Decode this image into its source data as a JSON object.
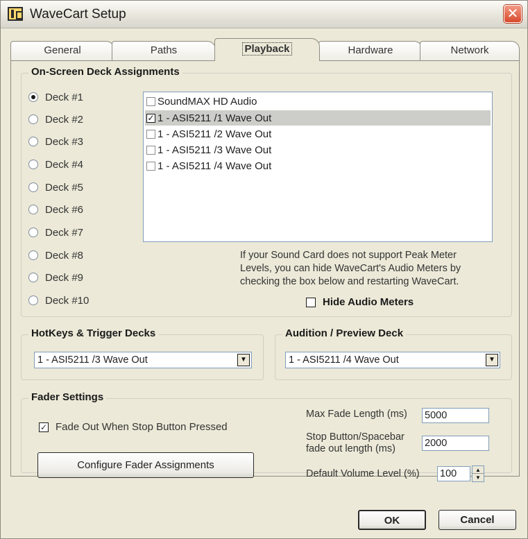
{
  "window": {
    "title": "WaveCart Setup"
  },
  "tabs": [
    {
      "label": "General"
    },
    {
      "label": "Paths"
    },
    {
      "label": "Playback",
      "active": true
    },
    {
      "label": "Hardware"
    },
    {
      "label": "Network"
    }
  ],
  "deck_assignments": {
    "title": "On-Screen Deck Assignments",
    "decks": [
      "Deck #1",
      "Deck #2",
      "Deck #3",
      "Deck #4",
      "Deck #5",
      "Deck #6",
      "Deck #7",
      "Deck #8",
      "Deck #9",
      "Deck #10"
    ],
    "selected_deck": "Deck #1",
    "devices": [
      {
        "label": "SoundMAX HD Audio",
        "checked": false
      },
      {
        "label": "1 - ASI5211 /1 Wave Out",
        "checked": true,
        "selected": true
      },
      {
        "label": "1 - ASI5211 /2 Wave Out",
        "checked": false
      },
      {
        "label": "1 - ASI5211 /3 Wave Out",
        "checked": false
      },
      {
        "label": "1 - ASI5211 /4 Wave Out",
        "checked": false
      }
    ],
    "note_lines": [
      "If your Sound Card does not support Peak Meter",
      "Levels, you can hide WaveCart's Audio Meters by",
      "checking the box below and restarting WaveCart."
    ],
    "hide_meters_label": "Hide Audio Meters",
    "hide_meters_checked": false
  },
  "hotkeys": {
    "title": "HotKeys & Trigger Decks",
    "value": "1 - ASI5211 /3 Wave Out"
  },
  "audition": {
    "title": "Audition / Preview Deck",
    "value": "1 - ASI5211 /4 Wave Out"
  },
  "fader": {
    "title": "Fader Settings",
    "fade_out_label": "Fade Out When Stop Button Pressed",
    "fade_out_checked": true,
    "configure_label": "Configure Fader Assignments",
    "max_fade_label": "Max Fade Length (ms)",
    "max_fade_value": "5000",
    "stop_fade_label_1": "Stop Button/Spacebar",
    "stop_fade_label_2": "fade out length (ms)",
    "stop_fade_value": "2000",
    "default_volume_label": "Default Volume Level (%)",
    "default_volume_value": "100"
  },
  "buttons": {
    "ok": "OK",
    "cancel": "Cancel"
  },
  "icons": {
    "app": "wavecart-app-icon",
    "close": "close-icon",
    "dropdown": "chevron-down-icon"
  }
}
